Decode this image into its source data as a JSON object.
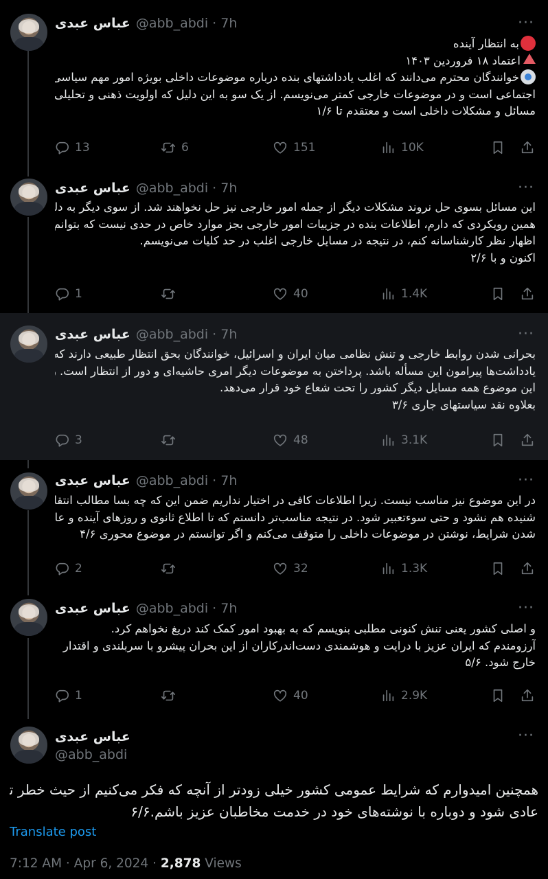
{
  "author": {
    "name": "عباس عبدی",
    "handle": "@abb_abdi"
  },
  "tweets": [
    {
      "time": "7h",
      "lines": [
        "به انتظار آینده",
        "اعتماد ۱۸ فروردین ۱۴۰۳",
        "خوانندگان محترم می‌دانند که اغلب یادداشتهای بنده درباره موضوعات داخلی بویژه امور مهم سیاسی و",
        "اجتماعی است و در موضوعات خارجی کمتر می‌نویسم. از یک سو به این دلیل که اولویت ذهنی و تحلیلی بنده",
        "مسائل و مشکلات داخلی است و معتقدم تا ۱/۶"
      ],
      "stats": {
        "replies": "13",
        "reposts": "6",
        "likes": "151",
        "views": "10K"
      }
    },
    {
      "time": "7h",
      "lines": [
        "این مسائل بسوی حل نروند مشکلات دیگر از جمله امور خارجی نیز حل نخواهند شد. از سوی دیگر به دلیل",
        "همین رویکردی که دارم، اطلاعات بنده در جزییات امور خارجی بجز موارد خاص در حدی نیست که بتوانم",
        "اظهار نظر کارشناسانه کنم، در نتیجه در مسایل خارجی اغلب در حد کلیات می‌نویسم.",
        "اکنون و با ۲/۶"
      ],
      "stats": {
        "replies": "1",
        "reposts": "",
        "likes": "40",
        "views": "1.4K"
      }
    },
    {
      "time": "7h",
      "lines": [
        "بحرانی شدن روابط خارجی و تنش نظامی میان ایران و اسرائیل، خوانندگان بحق انتظار طبیعی دارند که",
        "یادداشت‌ها پیرامون این مسأله باشد. پرداختن به موضوعات دیگر امری حاشیه‌ای و دور از انتظار است. زیرا",
        "این موضوع همه مسایل دیگر کشور را تحت شعاع خود قرار می‌دهد.",
        "بعلاوه نقد سیاستهای جاری ۳/۶"
      ],
      "stats": {
        "replies": "3",
        "reposts": "",
        "likes": "48",
        "views": "3.1K"
      }
    },
    {
      "time": "7h",
      "lines": [
        "در این موضوع نیز مناسب نیست. زیرا اطلاعات کافی در اختیار نداریم ضمن این که  چه بسا مطالب انتقادی",
        "شنیده هم نشود و حتی سوءتعبیر شود. در نتیجه مناسب‌تر دانستم که تا اطلاع ثانوی و روزهای آینده و عادی",
        "شدن شرایط، نوشتن در موضوعات داخلی را متوقف می‌کنم و اگر توانستم در موضوع محوری ۴/۶"
      ],
      "stats": {
        "replies": "2",
        "reposts": "",
        "likes": "32",
        "views": "1.3K"
      }
    },
    {
      "time": "7h",
      "lines": [
        "و اصلی کشور یعنی تنش کنونی مطلبی بنویسم که به بهبود امور کمک کند دریغ نخواهم کرد.",
        "آرزومندم که ایران عزیز با درایت و هوشمندی دست‌اندرکاران از این بحران پیشرو با سربلندی و اقتدار",
        "خارج شود. ۵/۶"
      ],
      "stats": {
        "replies": "1",
        "reposts": "",
        "likes": "40",
        "views": "2.9K"
      }
    }
  ],
  "main_tweet": {
    "lines": [
      "همچنین امیدوارم که شرایط عمومی کشور خیلی زودتر از آنچه که فکر می‌کنیم از حیث خطر تنش نظامی،",
      "عادی شود و دوباره با نوشته‌های خود در خدمت مخاطبان عزیز باشم.۶/۶"
    ],
    "translate": "Translate post",
    "timestamp": "7:12 AM · Apr 6, 2024 · ",
    "views_count": "2,878",
    "views_label": " Views"
  },
  "colors": {
    "background": "#000000",
    "highlight_row": "#16181c",
    "muted": "#71767b",
    "link": "#1d9bf0",
    "red_circle": "#e0303c"
  },
  "icons": [
    "reply-icon",
    "repost-icon",
    "like-icon",
    "views-icon",
    "bookmark-icon",
    "share-icon",
    "more-icon",
    "red-circle-emoji",
    "red-triangle-emoji",
    "blue-circle-emoji"
  ]
}
